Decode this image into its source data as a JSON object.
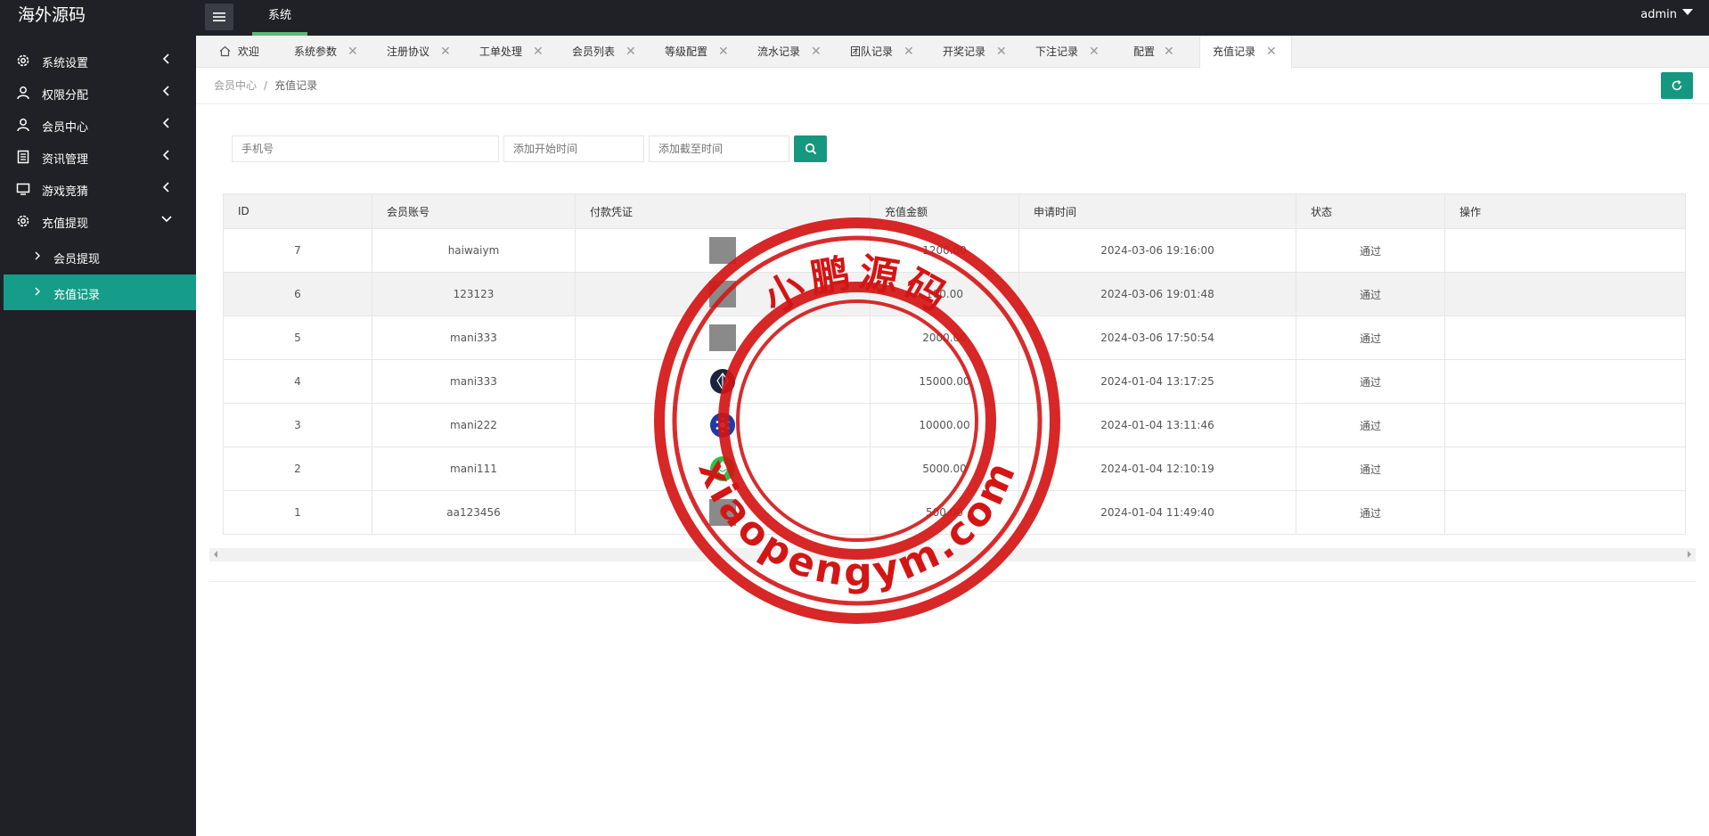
{
  "header": {
    "brand": "海外源码",
    "nav_item": "系统",
    "user": "admin"
  },
  "sidebar": {
    "items": [
      {
        "label": "系统设置",
        "icon": "gear-icon"
      },
      {
        "label": "权限分配",
        "icon": "user-icon"
      },
      {
        "label": "会员中心",
        "icon": "user-icon"
      },
      {
        "label": "资讯管理",
        "icon": "document-icon"
      },
      {
        "label": "游戏竞猜",
        "icon": "monitor-icon"
      },
      {
        "label": "充值提现",
        "icon": "gear-icon"
      }
    ],
    "sub_items": [
      {
        "label": "会员提现"
      },
      {
        "label": "充值记录"
      }
    ]
  },
  "tabs": [
    {
      "label": "欢迎",
      "closable": false
    },
    {
      "label": "系统参数",
      "closable": true
    },
    {
      "label": "注册协议",
      "closable": true
    },
    {
      "label": "工单处理",
      "closable": true
    },
    {
      "label": "会员列表",
      "closable": true
    },
    {
      "label": "等级配置",
      "closable": true
    },
    {
      "label": "流水记录",
      "closable": true
    },
    {
      "label": "团队记录",
      "closable": true
    },
    {
      "label": "开奖记录",
      "closable": true
    },
    {
      "label": "下注记录",
      "closable": true
    },
    {
      "label": "配置",
      "closable": true
    },
    {
      "label": "充值记录",
      "closable": true,
      "active": true
    }
  ],
  "breadcrumb": {
    "parent": "会员中心",
    "current": "充值记录",
    "separator": "/"
  },
  "search": {
    "phone_placeholder": "手机号",
    "start_placeholder": "添加开始时间",
    "end_placeholder": "添加截至时间"
  },
  "table": {
    "headers": [
      "ID",
      "会员账号",
      "付款凭证",
      "充值金额",
      "申请时间",
      "状态",
      "操作"
    ],
    "rows": [
      {
        "id": "7",
        "account": "haiwaiym",
        "voucher": "gray-image",
        "amount": "1200.00",
        "time": "2024-03-06 19:16:00",
        "status": "通过"
      },
      {
        "id": "6",
        "account": "123123",
        "voucher": "gray-image",
        "amount": "100.00",
        "time": "2024-03-06 19:01:48",
        "status": "通过"
      },
      {
        "id": "5",
        "account": "mani333",
        "voucher": "gray-image",
        "amount": "2000.00",
        "time": "2024-03-06 17:50:54",
        "status": "通过"
      },
      {
        "id": "4",
        "account": "mani333",
        "voucher": "eos-coin-icon",
        "amount": "15000.00",
        "time": "2024-01-04 13:17:25",
        "status": "通过"
      },
      {
        "id": "3",
        "account": "mani222",
        "voucher": "cardano-coin-icon",
        "amount": "10000.00",
        "time": "2024-01-04 13:11:46",
        "status": "通过"
      },
      {
        "id": "2",
        "account": "mani111",
        "voucher": "ethereum-classic-coin-icon",
        "amount": "5000.00",
        "time": "2024-01-04 12:10:19",
        "status": "通过"
      },
      {
        "id": "1",
        "account": "aa123456",
        "voucher": "gray-image",
        "amount": "500.00",
        "time": "2024-01-04 11:49:40",
        "status": "通过"
      }
    ]
  },
  "watermark": {
    "top_text": "小鹏源码",
    "bottom_text": "xiaopengym.com",
    "color": "#d41515"
  },
  "colors": {
    "accent": "#16977f",
    "active_sidebar": "#159d89",
    "status_ok": "#1a9a1a",
    "dark": "#1f2126"
  }
}
